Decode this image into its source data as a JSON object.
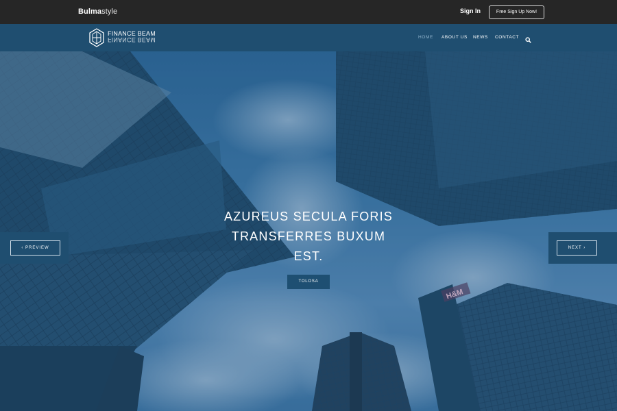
{
  "topbar": {
    "brand_bold": "Bulma",
    "brand_light": "style",
    "signin_label": "Sign In",
    "signup_label": "Free Sign Up Now!"
  },
  "navbar": {
    "logo_text": "FINANCE BEAM",
    "items": [
      {
        "label": "HOME",
        "active": true
      },
      {
        "label": "ABOUT US",
        "active": false
      },
      {
        "label": "NEWS",
        "active": false
      },
      {
        "label": "CONTACT",
        "active": false
      }
    ],
    "search_icon": "search-icon"
  },
  "hero": {
    "title": "AZUREUS SECULA FORIS TRANSFERRES BUXUM EST.",
    "button_label": "TOLOSA",
    "prev_label": "‹  PREVIEW",
    "next_label": "NEXT  ›",
    "sign_text": "H&M"
  },
  "colors": {
    "topbar": "#262626",
    "navbar": "#1f4e70",
    "accent": "#1e4f72"
  }
}
